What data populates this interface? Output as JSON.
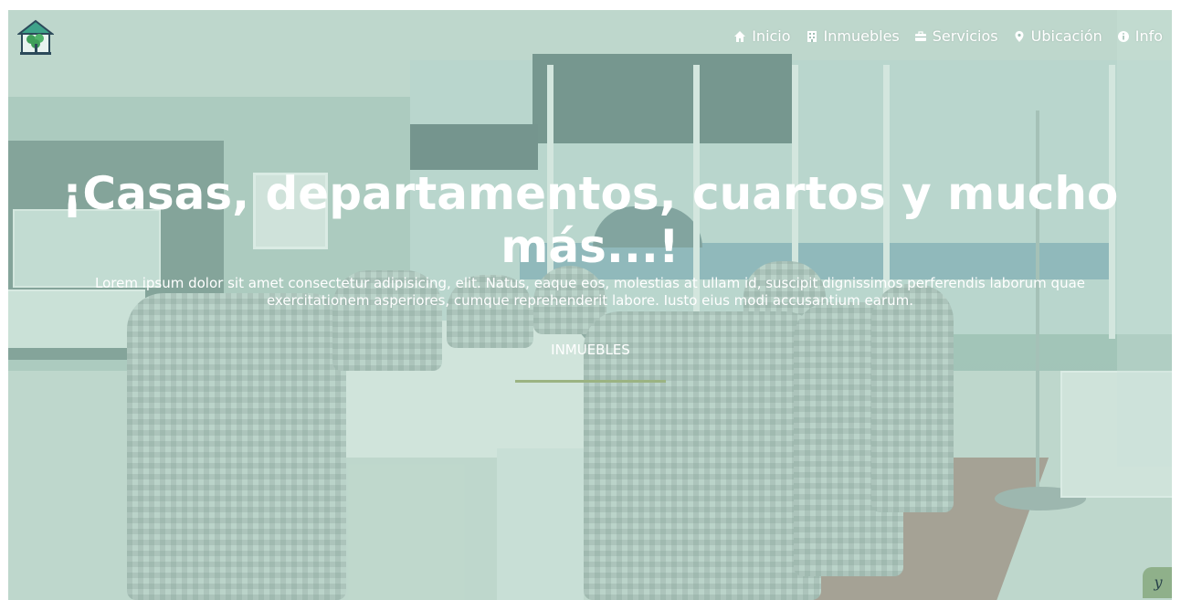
{
  "header": {
    "logo_icon": "house-tree-icon",
    "nav": [
      {
        "label": "Inicio",
        "icon": "home-icon"
      },
      {
        "label": "Inmuebles",
        "icon": "building-icon"
      },
      {
        "label": "Servicios",
        "icon": "briefcase-icon"
      },
      {
        "label": "Ubicación",
        "icon": "map-pin-icon"
      },
      {
        "label": "Info",
        "icon": "info-icon"
      }
    ]
  },
  "hero": {
    "title": "¡Casas, departamentos, cuartos y mucho más...!",
    "text": "Lorem ipsum dolor sit amet consectetur adipisicing, elit. Natus, eaque eos, molestias at ullam id, suscipit dignissimos perferendis laborum quae exercitationem asperiores, cumque reprehenderit labore. Iusto eius modi accusantium earum.",
    "button_label": "INMUEBLES",
    "button_underline_color": "#9bb382"
  },
  "chat_badge": {
    "label": "y",
    "color": "#8fb08a"
  },
  "colors": {
    "text": "#ffffff",
    "overlay": "#96c8b4"
  }
}
